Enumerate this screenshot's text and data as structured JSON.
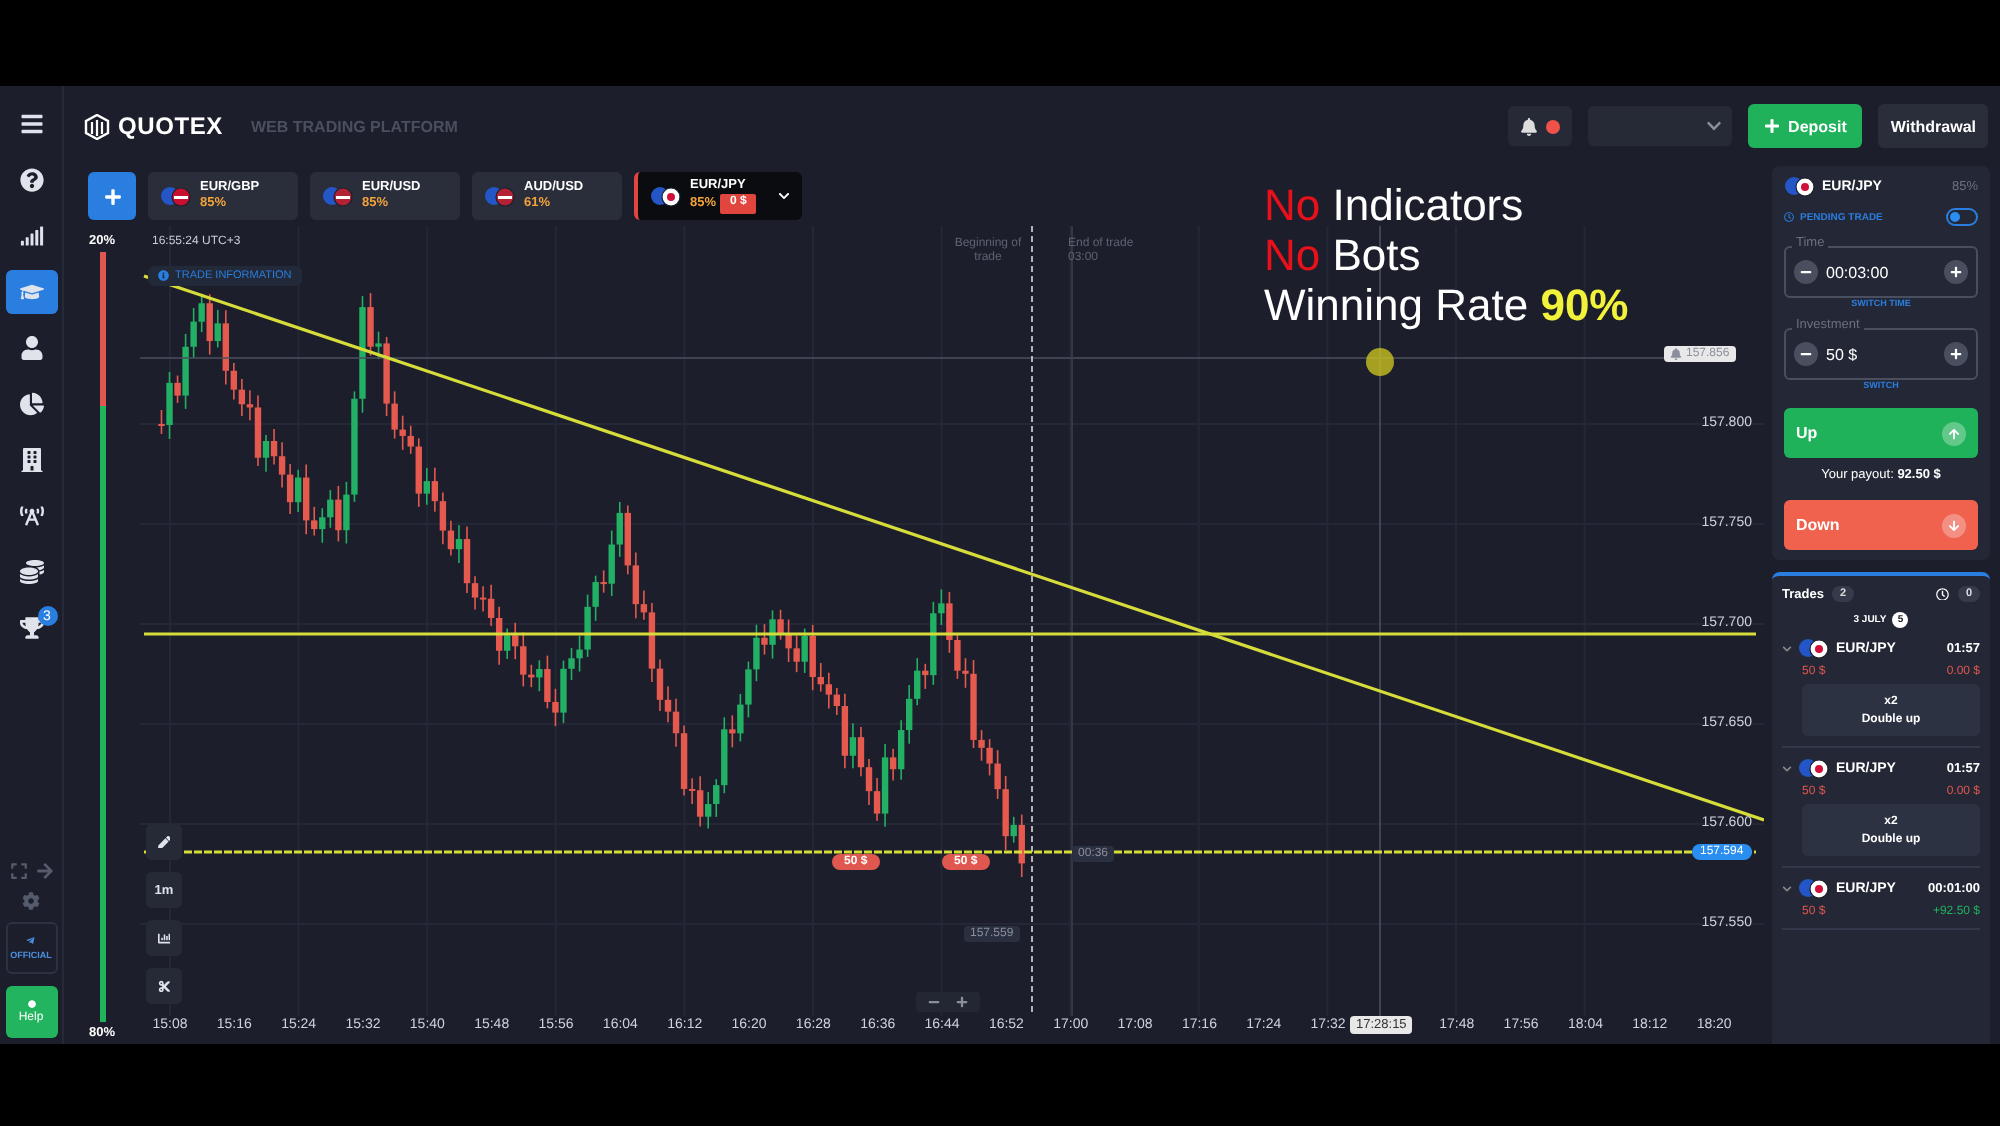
{
  "header": {
    "logo": "QUOTEX",
    "tagline": "WEB TRADING PLATFORM",
    "deposit": "Deposit",
    "withdrawal": "Withdrawal"
  },
  "nav": [
    {
      "selected": false
    },
    {
      "selected": false
    },
    {
      "selected": true
    },
    {
      "selected": false
    },
    {
      "selected": false
    },
    {
      "selected": false
    },
    {
      "selected": false
    },
    {
      "selected": false
    },
    {
      "selected": false,
      "badge": "3"
    }
  ],
  "nav_bottom": {
    "official": "OFFICIAL",
    "help": "Help"
  },
  "assets": [
    {
      "pair": "EUR/GBP",
      "payout": "85%",
      "selected": false
    },
    {
      "pair": "EUR/USD",
      "payout": "85%",
      "selected": false
    },
    {
      "pair": "AUD/USD",
      "payout": "61%",
      "selected": false
    },
    {
      "pair": "EUR/JPY",
      "payout": "85%",
      "selected": true,
      "amount": "0 $"
    }
  ],
  "sentiment": {
    "up": "20%",
    "down": "80%",
    "level": 0.2
  },
  "overlay": [
    {
      "kind": "negation",
      "accent": "No",
      "text": "Indicators"
    },
    {
      "kind": "negation",
      "accent": "No",
      "text": "Bots"
    },
    {
      "kind": "highlight",
      "text": "Winning Rate",
      "accent": "90%"
    }
  ],
  "chart": {
    "clock": "16:55:24",
    "timezone": "UTC+3",
    "info": "TRADE INFORMATION",
    "begin_marker": "Beginning of trade",
    "end_marker": "End of trade",
    "end_time": "03:00",
    "alert_price": "157.856",
    "current_price": "157.594",
    "low_price": "157.559",
    "countdown": "00:36",
    "crosshair_time": "17:28:15",
    "interval": "1m",
    "prices": [
      "157.800",
      "157.750",
      "157.700",
      "157.650",
      "157.600",
      "157.550"
    ],
    "times": [
      "15:08",
      "15:16",
      "15:24",
      "15:32",
      "15:40",
      "15:48",
      "15:56",
      "16:04",
      "16:12",
      "16:20",
      "16:28",
      "16:36",
      "16:44",
      "16:52",
      "17:00",
      "17:08",
      "17:16",
      "17:24",
      "17:32",
      "17:48",
      "17:56",
      "18:04",
      "18:12",
      "18:20"
    ],
    "orders": [
      {
        "amount": "50 $"
      },
      {
        "amount": "50 $"
      }
    ]
  },
  "trade_panel": {
    "pair": "EUR/JPY",
    "payout": "85%",
    "pending_label": "PENDING TRADE",
    "pending_on": false,
    "time_label": "Time",
    "time": "00:03:00",
    "switch_time": "SWITCH TIME",
    "investment_label": "Investment",
    "investment": "50 $",
    "switch": "SWITCH",
    "up": "Up",
    "payout_label": "Your payout:",
    "payout_value": "92.50 $",
    "down": "Down"
  },
  "trades": {
    "title": "Trades",
    "count": "2",
    "history_count": "0",
    "date": "3 JULY",
    "date_badge": "5",
    "items": [
      {
        "kind": "open",
        "pair": "EUR/JPY",
        "time": "01:57",
        "stake": "50 $",
        "result": "0.00 $",
        "multiplier": "x2",
        "action": "Double up"
      },
      {
        "kind": "open",
        "pair": "EUR/JPY",
        "time": "01:57",
        "stake": "50 $",
        "result": "0.00 $",
        "multiplier": "x2",
        "action": "Double up"
      },
      {
        "kind": "win",
        "pair": "EUR/JPY",
        "time": "00:01:00",
        "stake": "50 $",
        "result": "+92.50 $"
      }
    ]
  }
}
